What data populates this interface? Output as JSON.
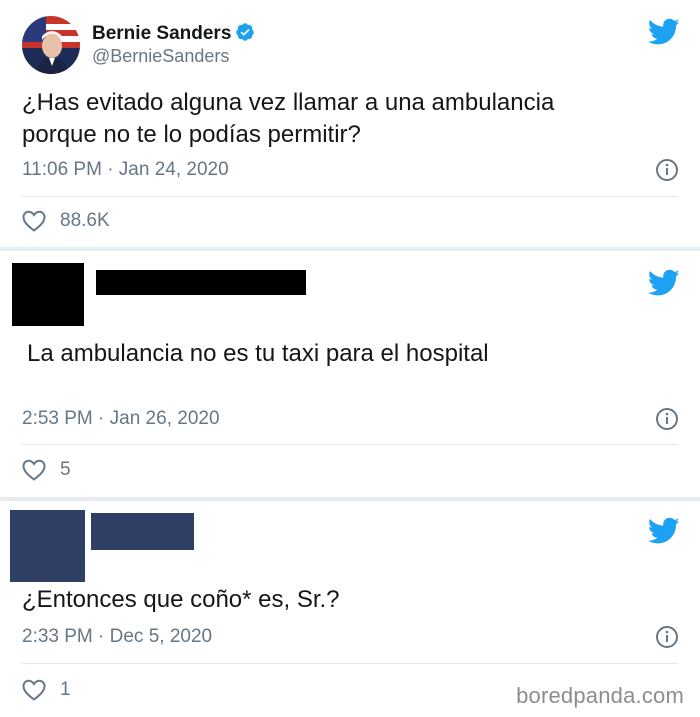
{
  "colors": {
    "twitter_blue": "#1da1f2",
    "text_primary": "#14171a",
    "text_secondary": "#657786",
    "divider": "#e1e8ed",
    "redaction_black": "#000000",
    "redaction_navy": "#2f3f66"
  },
  "tweets": [
    {
      "author_name": "Bernie Sanders",
      "author_handle": "@BernieSanders",
      "verified": true,
      "text_lines": [
        "¿Has evitado alguna vez llamar a una ambulancia",
        "porque no te lo podías permitir?"
      ],
      "timestamp": "11:06 PM · Jan 24, 2020",
      "likes": "88.6K",
      "icons": [
        "twitter-bird-icon",
        "verified-badge-icon",
        "info-icon",
        "heart-icon"
      ]
    },
    {
      "author_name": "",
      "author_handle": "",
      "redacted": true,
      "text_lines": [
        "La ambulancia no es tu taxi para el hospital"
      ],
      "timestamp": "2:53 PM · Jan 26, 2020",
      "likes": "5"
    },
    {
      "author_name": "",
      "author_handle": "",
      "redacted": true,
      "text_lines": [
        "¿Entonces que coño* es, Sr.?"
      ],
      "timestamp": "2:33 PM · Dec 5, 2020",
      "likes": "1"
    }
  ],
  "watermark": "boredpanda.com"
}
